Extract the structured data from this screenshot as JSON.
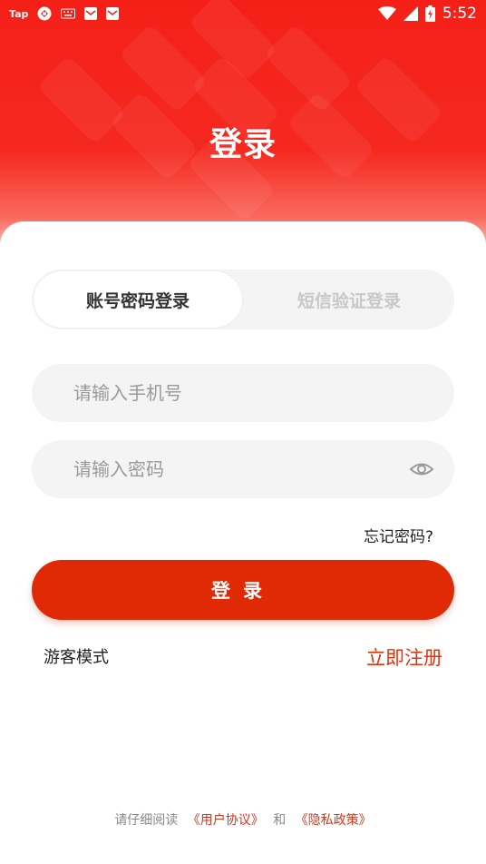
{
  "status_bar": {
    "app_tag": "Tap",
    "time": "5:52",
    "icons": [
      "taptap-icon",
      "clover-icon",
      "keyboard-icon",
      "mail-icon",
      "mail-icon",
      "wifi-icon",
      "signal-icon",
      "battery-charging-icon"
    ]
  },
  "header": {
    "title": "登录"
  },
  "tabs": [
    {
      "label": "账号密码登录",
      "active": true
    },
    {
      "label": "短信验证登录",
      "active": false
    }
  ],
  "form": {
    "phone_placeholder": "请输入手机号",
    "phone_value": "",
    "password_placeholder": "请输入密码",
    "password_value": "",
    "forgot_label": "忘记密码?",
    "login_label": "登录"
  },
  "footer_links": {
    "guest_label": "游客模式",
    "register_label": "立即注册"
  },
  "agreement": {
    "prefix": "请仔细阅读",
    "user_agreement": "《用户协议》",
    "conjunction": "和",
    "privacy_policy": "《隐私政策》"
  },
  "colors": {
    "brand_red": "#f42018",
    "button_red": "#e02a06",
    "link_red": "#d4361c"
  }
}
